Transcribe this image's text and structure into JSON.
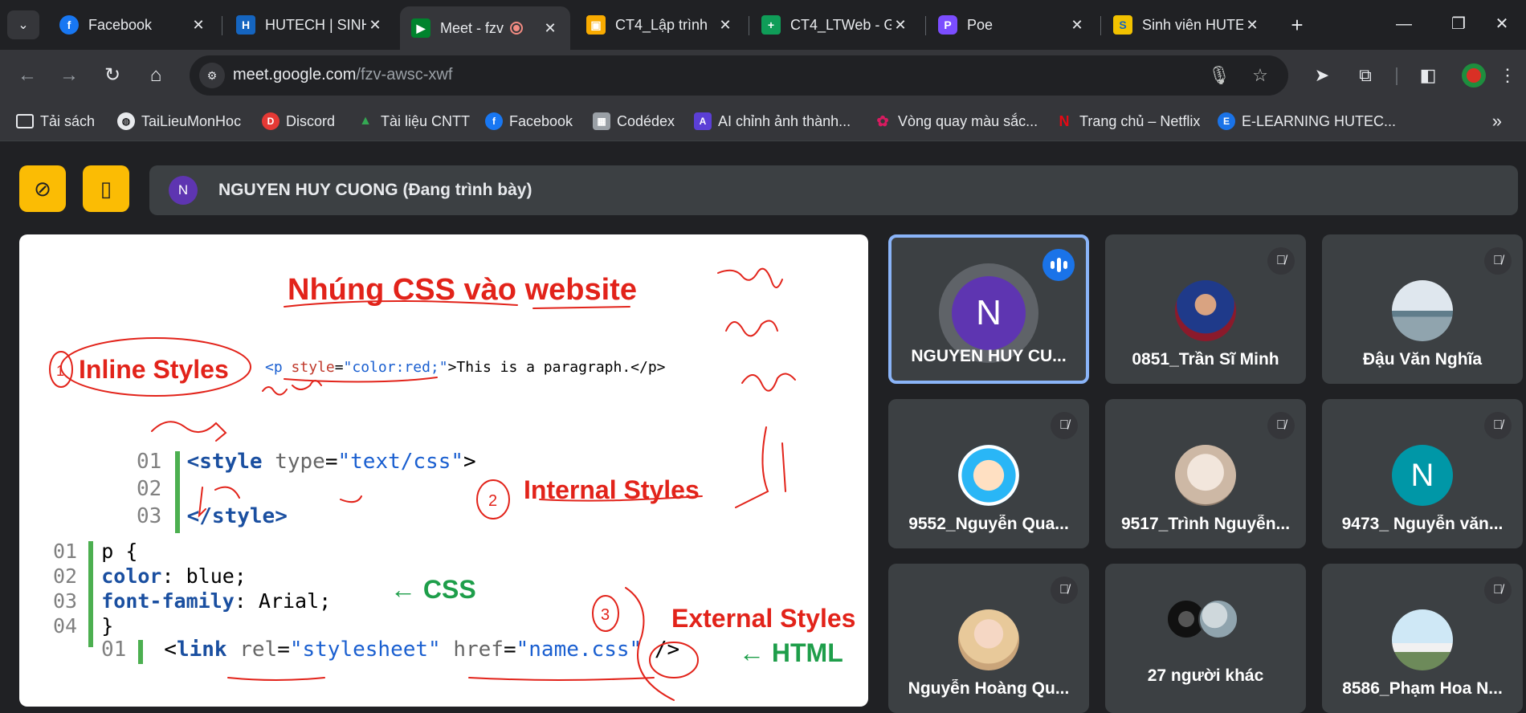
{
  "browser": {
    "tabs": [
      {
        "title": "Facebook",
        "favicon": "facebook-icon",
        "color": "#1877f2",
        "glyph": "f"
      },
      {
        "title": "HUTECH | SINH",
        "favicon": "hutech-shield-icon",
        "color": "#1565c0",
        "glyph": "H"
      },
      {
        "title": "Meet - fzv",
        "favicon": "google-meet-icon",
        "color": "#00832d",
        "glyph": "M",
        "active": true,
        "recording": true
      },
      {
        "title": "CT4_Lập trình",
        "favicon": "google-classroom-icon",
        "color": "#f9ab00",
        "glyph": "C"
      },
      {
        "title": "CT4_LTWeb - G",
        "favicon": "google-sheets-icon",
        "color": "#0f9d58",
        "glyph": "+"
      },
      {
        "title": "Poe",
        "favicon": "poe-icon",
        "color": "#7b4dff",
        "glyph": "P"
      },
      {
        "title": "Sinh viên HUTE",
        "favicon": "hutech-student-icon",
        "color": "#f2c200",
        "glyph": "S"
      }
    ],
    "url_host": "meet.google.com",
    "url_path": "/fzv-awsc-xwf",
    "bookmarks": [
      {
        "label": "Tải sách",
        "icon": "folder-icon",
        "color": "#35363a",
        "glyph": "▭"
      },
      {
        "label": "TaiLieuMonHoc",
        "icon": "globe-icon",
        "color": "#5f6368",
        "glyph": "◍"
      },
      {
        "label": "Discord",
        "icon": "discord-icon",
        "color": "#e53935",
        "glyph": "D"
      },
      {
        "label": "Tài liệu CNTT",
        "icon": "google-drive-icon",
        "color": "#34a853",
        "glyph": "▲"
      },
      {
        "label": "Facebook",
        "icon": "facebook-icon",
        "color": "#1877f2",
        "glyph": "f"
      },
      {
        "label": "Codédex",
        "icon": "codedex-icon",
        "color": "#9aa0a6",
        "glyph": "▦"
      },
      {
        "label": "AI chỉnh ảnh thành...",
        "icon": "ai-photo-icon",
        "color": "#5b3fd6",
        "glyph": "A"
      },
      {
        "label": "Vòng quay màu sắc...",
        "icon": "color-wheel-icon",
        "color": "#d81b60",
        "glyph": "✿"
      },
      {
        "label": "Trang chủ – Netflix",
        "icon": "netflix-icon",
        "color": "#e50914",
        "glyph": "N"
      },
      {
        "label": "E-LEARNING HUTEC...",
        "icon": "elearning-icon",
        "color": "#1a73e8",
        "glyph": "E"
      }
    ]
  },
  "meet": {
    "presenter_initial": "N",
    "presenter_text": "NGUYEN HUY CUONG (Đang trình bày)",
    "slide": {
      "title": "Nhúng CSS vào website",
      "inline_label": "Inline Styles",
      "inline_code_tag_open": "<p ",
      "inline_code_attr": "style",
      "inline_code_val": "\"color:red;\"",
      "inline_code_rest": ">This is a paragraph.</p>",
      "internal_label": "Internal Styles",
      "internal_lines": [
        {
          "n": "01",
          "a": "<style ",
          "b": "type",
          "c": "=",
          "d": "\"text/css\"",
          "e": ">"
        },
        {
          "n": "02",
          "a": "",
          "b": "",
          "c": "",
          "d": "",
          "e": ""
        },
        {
          "n": "03",
          "a": "</style>",
          "b": "",
          "c": "",
          "d": "",
          "e": ""
        }
      ],
      "css_lines": [
        {
          "n": "01",
          "a": "p {",
          "b": ""
        },
        {
          "n": "02",
          "a": "color",
          "b": ": blue;"
        },
        {
          "n": "03",
          "a": "font-family",
          "b": ": Arial;"
        },
        {
          "n": "04",
          "a": "}",
          "b": ""
        }
      ],
      "css_arrow": "← CSS",
      "external_label": "External Styles",
      "link_line_no": "01",
      "link_parts": [
        "<",
        "link",
        " ",
        "rel",
        "=",
        "\"stylesheet\"",
        " ",
        "href",
        "=",
        "\"name.css\"",
        " />"
      ],
      "html_arrow": "← HTML",
      "annot_circle_1": "1",
      "annot_circle_2": "2",
      "annot_circle_3": "3"
    },
    "participants": [
      {
        "name": "NGUYEN HUY CU...",
        "initial": "N",
        "speaking": true,
        "avatar_color": "#5e35b1"
      },
      {
        "name": "0851_Trần Sĩ Minh",
        "avatar": "photo-avatar",
        "avatar_color": "#3949ab"
      },
      {
        "name": "Đậu Văn Nghĩa",
        "avatar": "photo-avatar",
        "avatar_color": "#b0bec5"
      },
      {
        "name": "9552_Nguyễn Qua...",
        "avatar": "photo-avatar",
        "avatar_color": "#29b6f6"
      },
      {
        "name": "9517_Trình Nguyễn...",
        "avatar": "photo-avatar",
        "avatar_color": "#d7ccc8"
      },
      {
        "name": "9473_ Nguyễn văn...",
        "initial": "N",
        "avatar_color": "#0097a7"
      },
      {
        "name": "Nguyễn Hoàng Qu...",
        "avatar": "photo-avatar",
        "avatar_color": "#e0c8b8"
      },
      {
        "name": "27 người khác",
        "avatar": "group-avatars",
        "avatar_color": "#90a4ae"
      },
      {
        "name": "8586_Phạm Hoa N...",
        "avatar": "photo-avatar",
        "avatar_color": "#81d4fa"
      }
    ]
  }
}
